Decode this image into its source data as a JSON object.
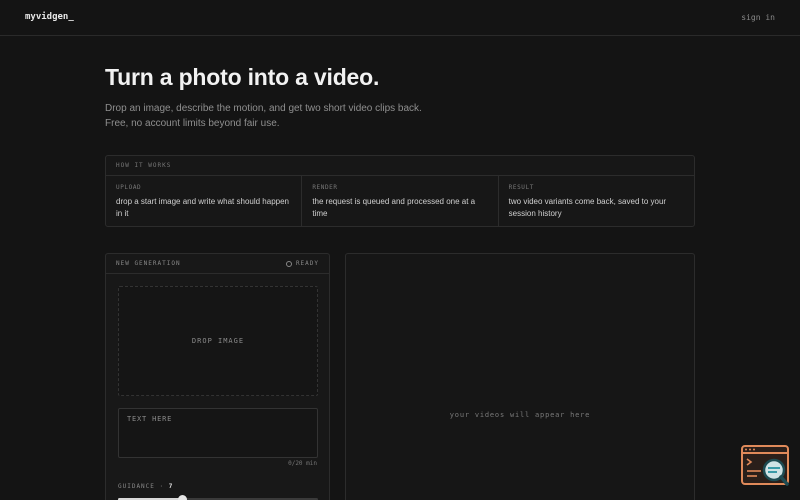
{
  "header": {
    "brand": "myvidgen_",
    "signin_label": "sign in"
  },
  "hero": {
    "title": "Turn a photo into a video.",
    "subtitle_line1": "Drop an image, describe the motion, and get two short video clips back.",
    "subtitle_line2": "Free, no account limits beyond fair use."
  },
  "how_it_works": {
    "heading": "HOW IT WORKS",
    "steps": [
      {
        "label": "UPLOAD",
        "text": "drop a start image and write what should happen in it"
      },
      {
        "label": "RENDER",
        "text": "the request is queued and processed one at a time"
      },
      {
        "label": "RESULT",
        "text": "two video variants come back, saved to your session history"
      }
    ]
  },
  "generation": {
    "heading": "NEW GENERATION",
    "status": "READY",
    "dropzone_label": "DROP IMAGE",
    "prompt_placeholder": "TEXT HERE",
    "prompt_value": "",
    "counter": "0/20 min",
    "guidance_label": "GUIDANCE ·",
    "guidance_value": "7",
    "guidance_fraction": 0.32
  },
  "results": {
    "empty_text": "your videos will appear here"
  },
  "helper_widget": {
    "icon": "terminal-search-icon",
    "accent_color": "#e08a5a",
    "lens_color": "#3a9aa8"
  }
}
